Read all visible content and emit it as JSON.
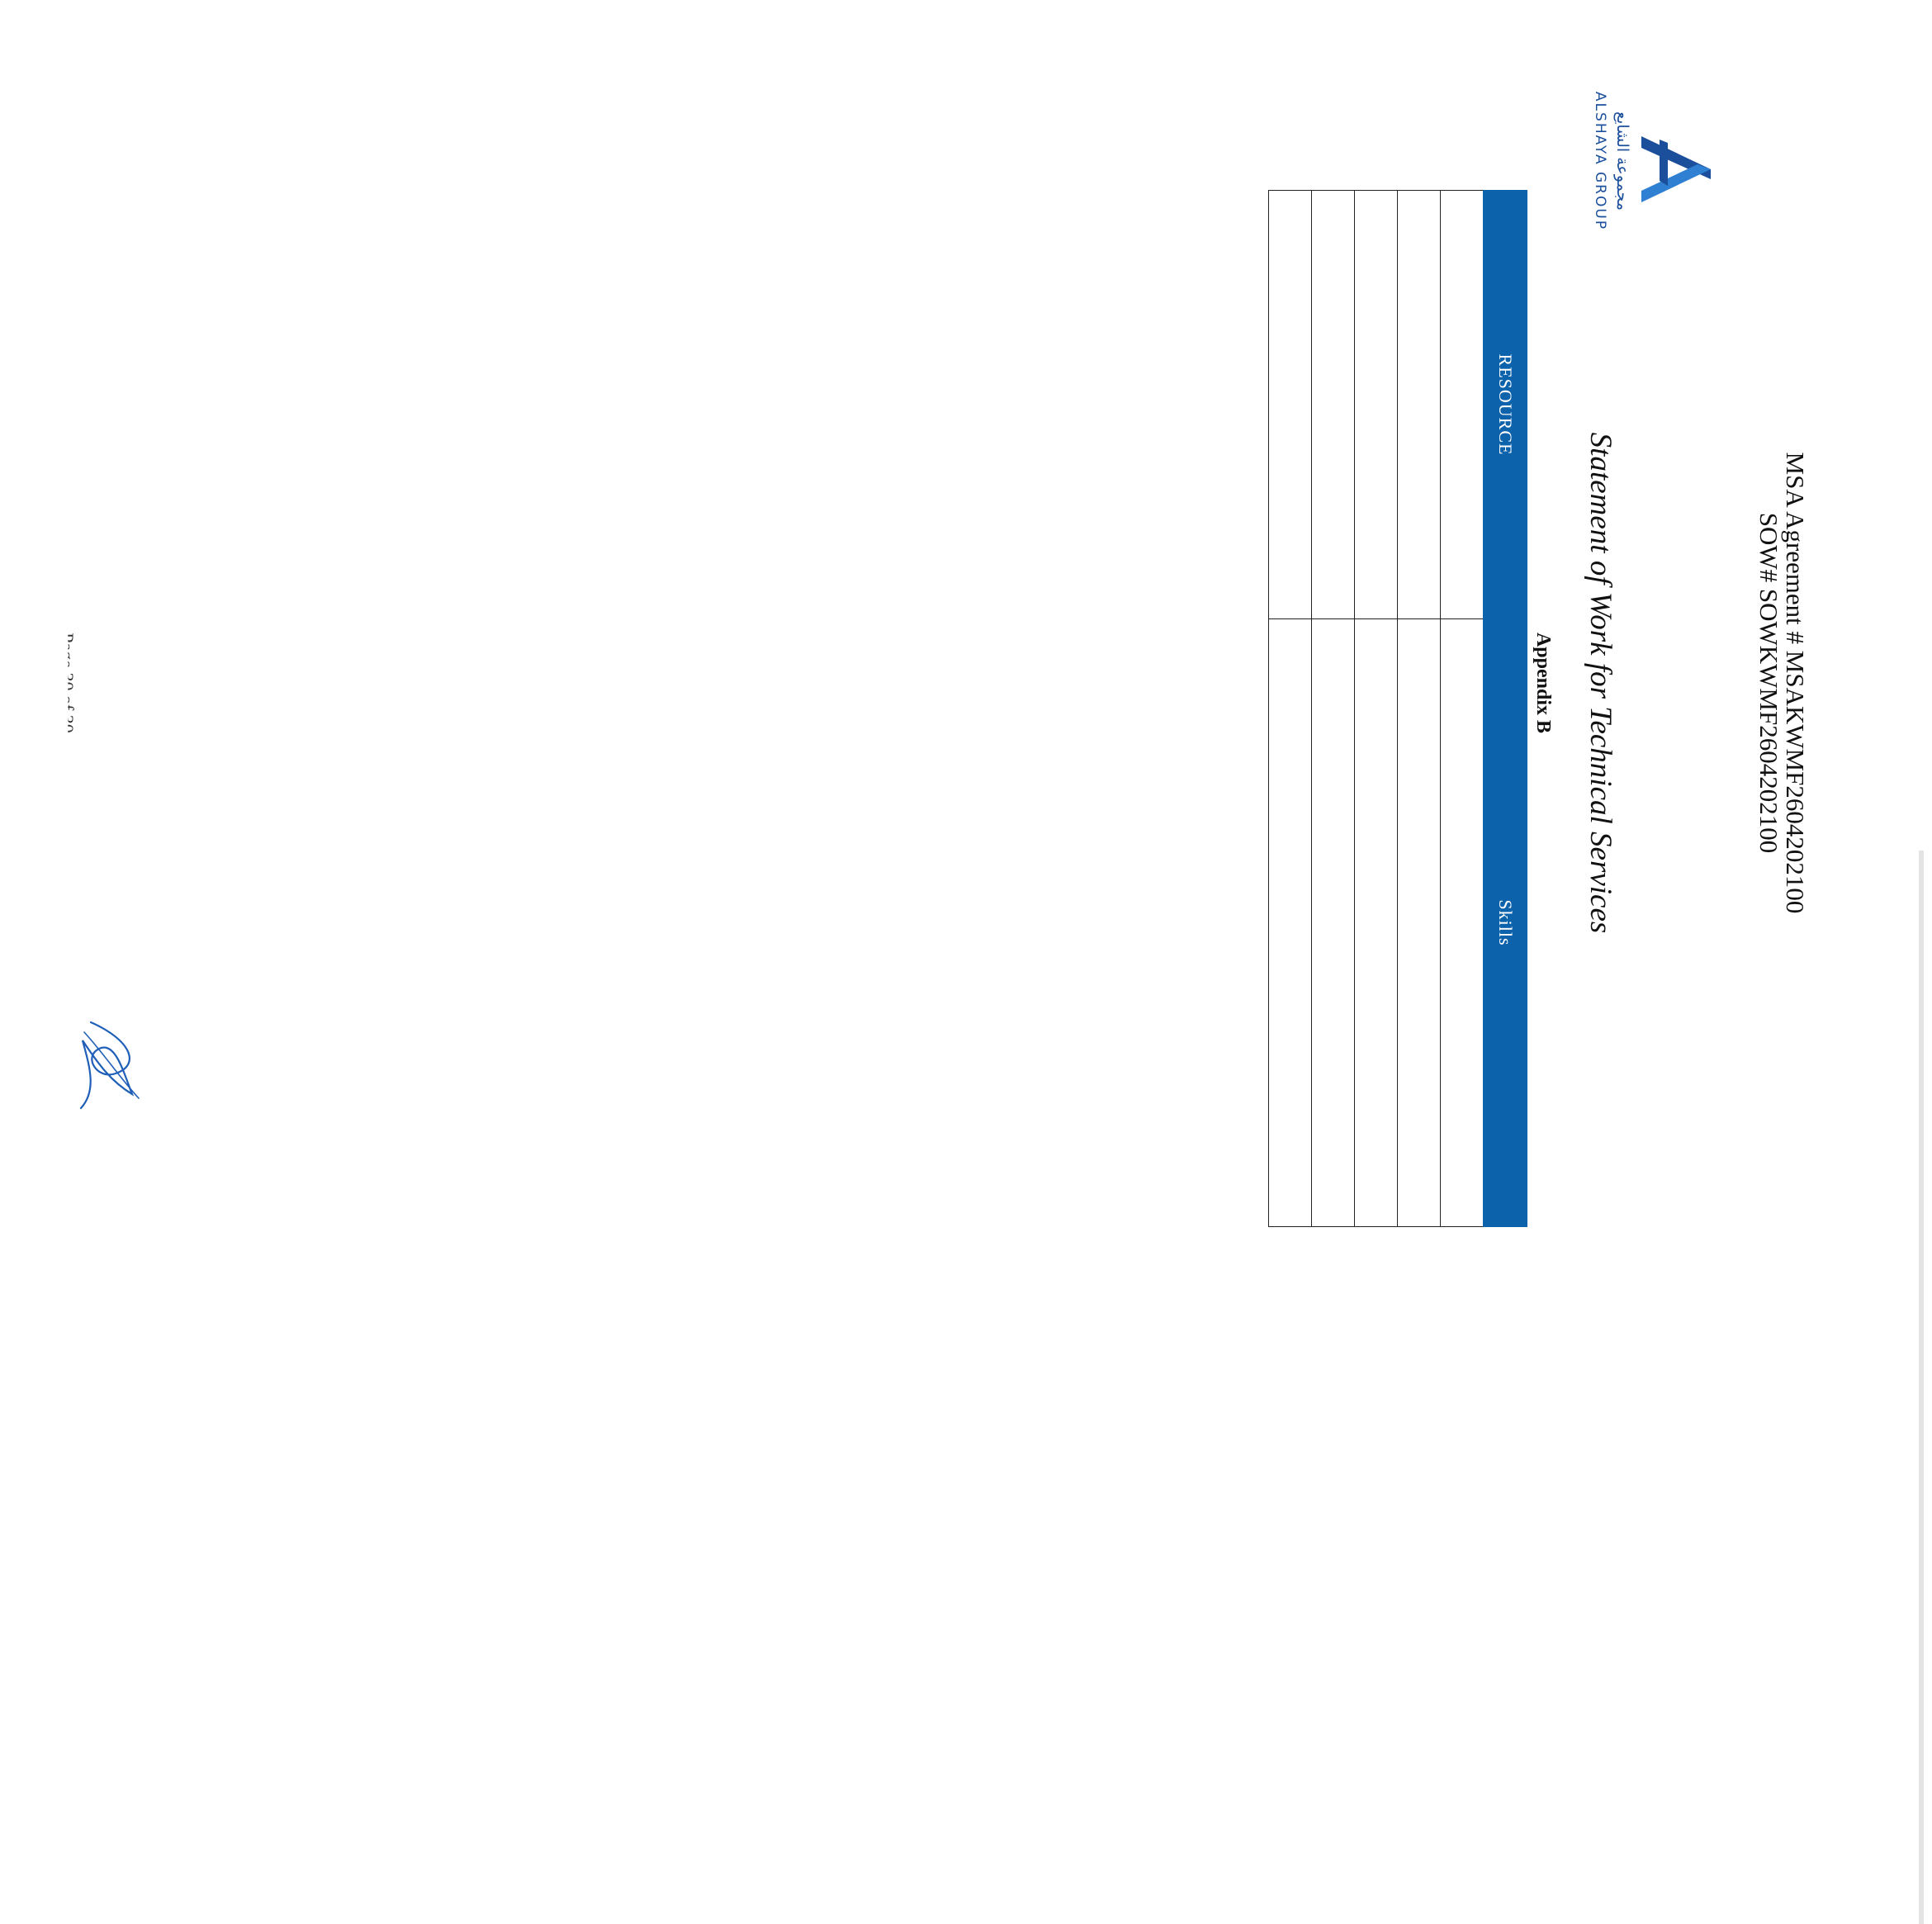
{
  "header": {
    "msa_agreement": "MSA Agreement # MSAKWMF2604202100",
    "sow_number": "SOW# SOWKWMF2604202100",
    "title": "Statement of Work for Technical Services",
    "appendix": "Appendix B"
  },
  "logo": {
    "arabic_text": "مجموعة الشايع",
    "english_text": "ALSHAYA GROUP",
    "brand_color": "#1b4f9c"
  },
  "table": {
    "header_color": "#0d62ac",
    "columns": [
      "RESOURCE",
      "Skills"
    ],
    "rows": [
      [
        "",
        ""
      ],
      [
        "",
        ""
      ],
      [
        "",
        ""
      ],
      [
        "",
        ""
      ],
      [
        "",
        ""
      ]
    ]
  },
  "footer": {
    "page_number": "Page 30 of 30"
  },
  "signature": {
    "color": "#1f5fb8"
  }
}
